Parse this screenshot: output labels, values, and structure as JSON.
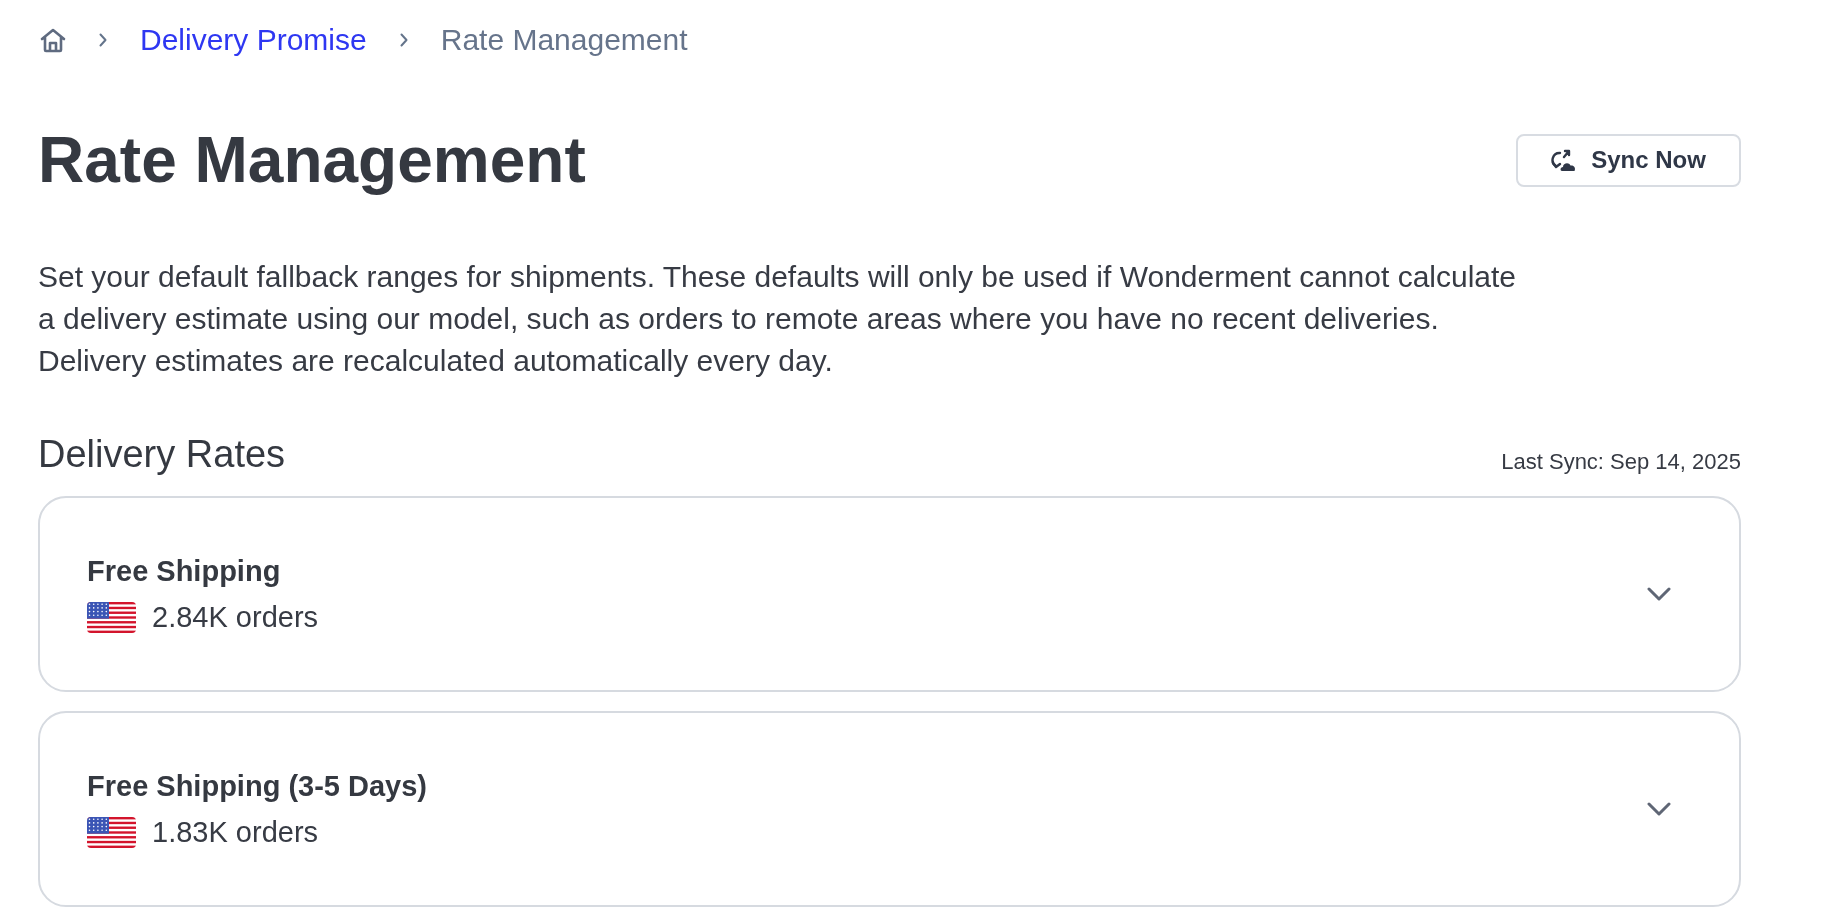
{
  "breadcrumb": [
    {
      "kind": "home"
    },
    {
      "kind": "link",
      "label": "Delivery Promise"
    },
    {
      "kind": "current",
      "label": "Rate Management"
    }
  ],
  "header": {
    "title": "Rate Management",
    "sync_button": "Sync Now"
  },
  "description": "Set your default fallback ranges for shipments. These defaults will only be used if Wonderment cannot calculate a delivery estimate using our model, such as orders to remote areas where you have no recent deliveries. Delivery estimates are recalculated automatically every day.",
  "delivery_rates": {
    "heading": "Delivery Rates",
    "last_sync": "Last Sync: Sep 14, 2025",
    "rates": [
      {
        "name": "Free Shipping",
        "orders": "2.84K orders",
        "expanded": false
      },
      {
        "name": "Free Shipping (3-5 Days)",
        "orders": "1.83K orders",
        "expanded": false
      }
    ]
  }
}
